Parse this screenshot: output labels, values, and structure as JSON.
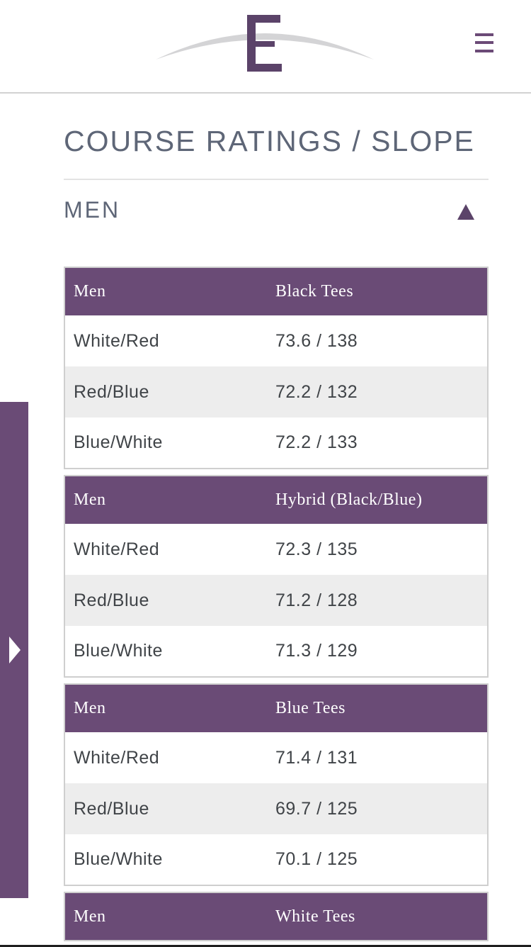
{
  "page": {
    "title": "COURSE RATINGS / SLOPE"
  },
  "header": {
    "logo_icon": "club-logo-icon",
    "menu_icon": "hamburger-menu-icon"
  },
  "section": {
    "label": "MEN",
    "toggle_icon": "triangle-up-icon",
    "expanded": true
  },
  "side_tab": {
    "icon": "triangle-right-icon"
  },
  "colors": {
    "accent": "#6a4b76",
    "title_text": "#5e6677",
    "stripe": "#ededed"
  },
  "tables": [
    {
      "header": [
        "Men",
        "Black Tees"
      ],
      "rows": [
        [
          "White/Red",
          "73.6 / 138"
        ],
        [
          "Red/Blue",
          "72.2 / 132"
        ],
        [
          "Blue/White",
          "72.2 / 133"
        ]
      ]
    },
    {
      "header": [
        "Men",
        "Hybrid (Black/Blue)"
      ],
      "rows": [
        [
          "White/Red",
          "72.3 / 135"
        ],
        [
          "Red/Blue",
          "71.2 / 128"
        ],
        [
          "Blue/White",
          "71.3 / 129"
        ]
      ]
    },
    {
      "header": [
        "Men",
        "Blue Tees"
      ],
      "rows": [
        [
          "White/Red",
          "71.4 / 131"
        ],
        [
          "Red/Blue",
          "69.7 / 125"
        ],
        [
          "Blue/White",
          "70.1 / 125"
        ]
      ]
    },
    {
      "header": [
        "Men",
        "White Tees"
      ],
      "rows": []
    }
  ]
}
